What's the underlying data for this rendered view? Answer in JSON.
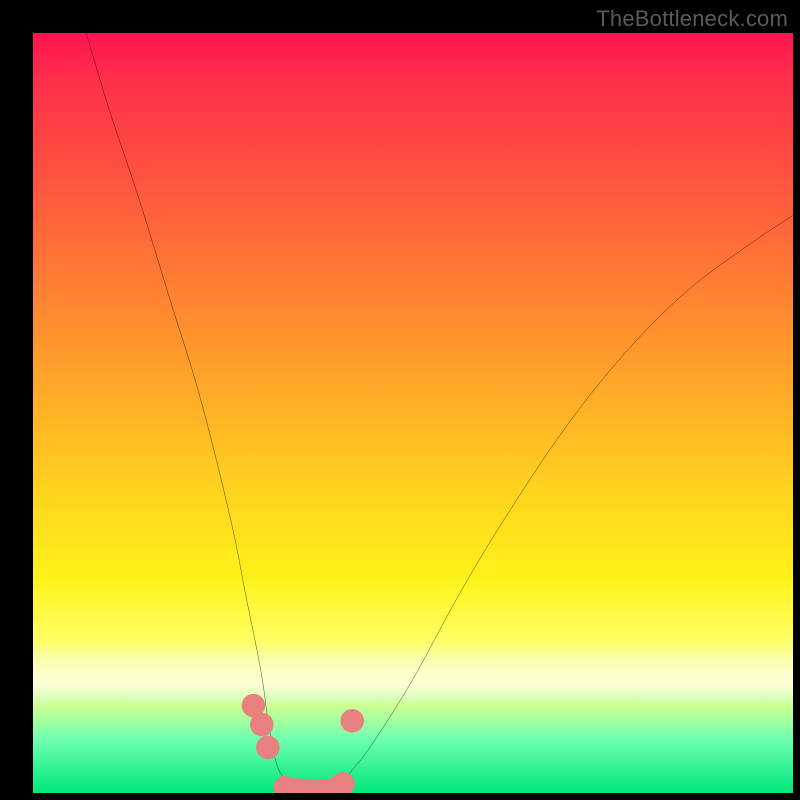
{
  "attribution": "TheBottleneck.com",
  "chart_data": {
    "type": "line",
    "title": "",
    "xlabel": "",
    "ylabel": "",
    "xlim": [
      0,
      100
    ],
    "ylim": [
      0,
      100
    ],
    "grid": false,
    "legend": false,
    "background_gradient": {
      "top_color": "#ff1450",
      "mid_color": "#ffd21e",
      "bottom_color": "#00e77a"
    },
    "series": [
      {
        "name": "left-branch",
        "stroke": "#000000",
        "x": [
          7,
          10,
          14,
          18,
          22,
          26,
          28,
          30,
          31,
          32,
          33,
          34,
          36,
          38
        ],
        "y": [
          100,
          90,
          78,
          65,
          52,
          36,
          26,
          16,
          9,
          4,
          2,
          1,
          0,
          0
        ]
      },
      {
        "name": "right-branch",
        "stroke": "#000000",
        "x": [
          38,
          40,
          42,
          45,
          50,
          56,
          62,
          70,
          78,
          86,
          94,
          100
        ],
        "y": [
          0,
          1,
          3,
          7,
          15,
          26,
          36,
          48,
          58,
          66,
          72,
          76
        ]
      },
      {
        "name": "valley-markers-left",
        "type": "scatter",
        "color": "#e98080",
        "x": [
          29.0,
          30.1,
          30.9
        ],
        "y": [
          11.5,
          9.0,
          6.0
        ]
      },
      {
        "name": "valley-markers-bottom",
        "type": "scatter",
        "color": "#e98080",
        "x": [
          33.2,
          34.8,
          36.4,
          38.0,
          39.6,
          40.8
        ],
        "y": [
          0.7,
          0.4,
          0.3,
          0.3,
          0.5,
          1.2
        ]
      },
      {
        "name": "valley-markers-right",
        "type": "scatter",
        "color": "#e98080",
        "x": [
          42.0
        ],
        "y": [
          9.5
        ]
      }
    ]
  }
}
